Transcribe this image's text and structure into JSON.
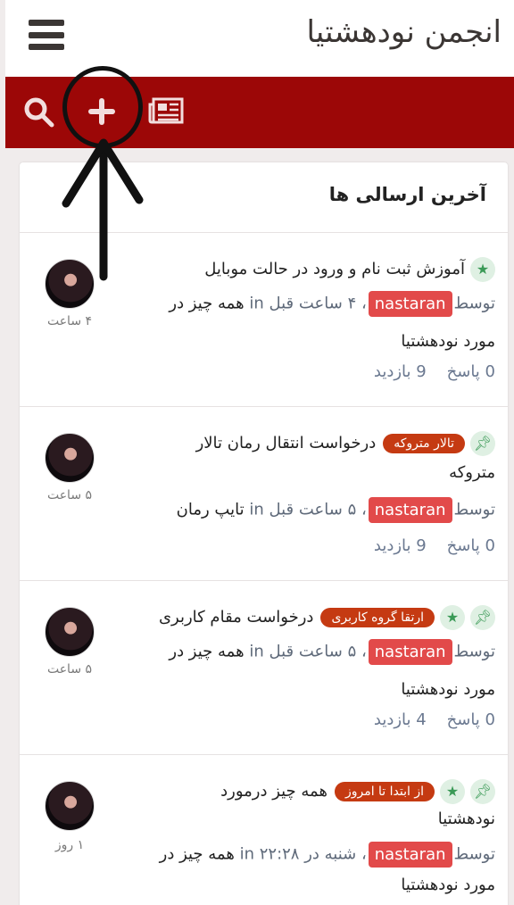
{
  "header": {
    "title": "انجمن نودهشتیا",
    "menu_icon": "hamburger-menu-icon"
  },
  "toolbar": {
    "icons": [
      "search-icon",
      "plus-icon",
      "newspaper-icon"
    ],
    "color": "#9c0707"
  },
  "section": {
    "title": "آخرین ارسالی ها"
  },
  "posts": [
    {
      "title": "آموزش ثبت نام و ورود در حالت موبایل",
      "tag": "",
      "by": "توسط",
      "user": "nastaran",
      "time": "، ۴ ساعت قبل",
      "in": "in",
      "forum1": "همه چیز در",
      "forum2": "مورد نودهشتیا",
      "replies": "0 پاسخ",
      "views": "9 بازدید",
      "age": "۴ ساعت"
    },
    {
      "title1": "درخواست انتقال رمان تالار",
      "title2": "متروکه",
      "tag": "تالار متروکه",
      "by": "توسط",
      "user": "nastaran",
      "time": "، ۵ ساعت قبل",
      "in": "in",
      "forum1": "تایپ رمان",
      "replies": "0 پاسخ",
      "views": "9 بازدید",
      "age": "۵ ساعت"
    },
    {
      "title": "درخواست مقام کاربری",
      "tag": "ارتقا گروه کاربری",
      "by": "توسط",
      "user": "nastaran",
      "time": "، ۵ ساعت قبل",
      "in": "in",
      "forum1": "همه چیز در",
      "forum2": "مورد نودهشتیا",
      "replies": "0 پاسخ",
      "views": "4 بازدید",
      "age": "۵ ساعت"
    },
    {
      "title1": "همه چیز درمورد",
      "title2": "نودهشتیا",
      "tag": "از ابتدا تا امروز",
      "by": "توسط",
      "user": "nastaran",
      "time": "، شنبه در ۲۲:۲۸",
      "in": "in",
      "forum1": "همه چیز در",
      "forum2": "مورد نودهشتیا",
      "age": "۱ روز"
    }
  ]
}
